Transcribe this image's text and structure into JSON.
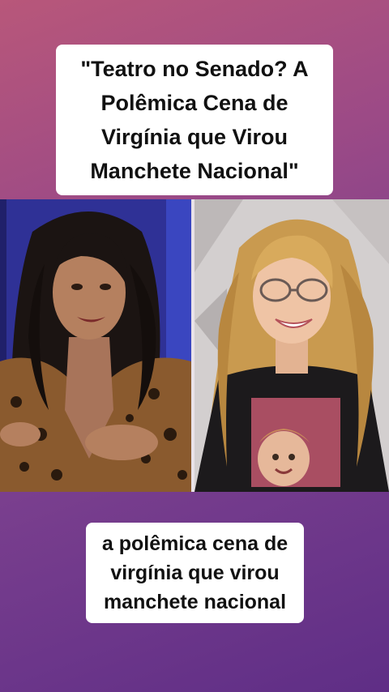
{
  "title": {
    "text": "\"Teatro no Senado? A\nPolêmica Cena de\nVirgínia que Virou\nManchete Nacional\""
  },
  "caption": {
    "text": "a polêmica cena de\nvirgínia que virou\nmanchete nacional"
  },
  "photos": {
    "left_subject": "woman with dark wavy hair in leopard-print top",
    "right_subject": "woman with long blonde hair and glasses in black printed t-shirt"
  }
}
